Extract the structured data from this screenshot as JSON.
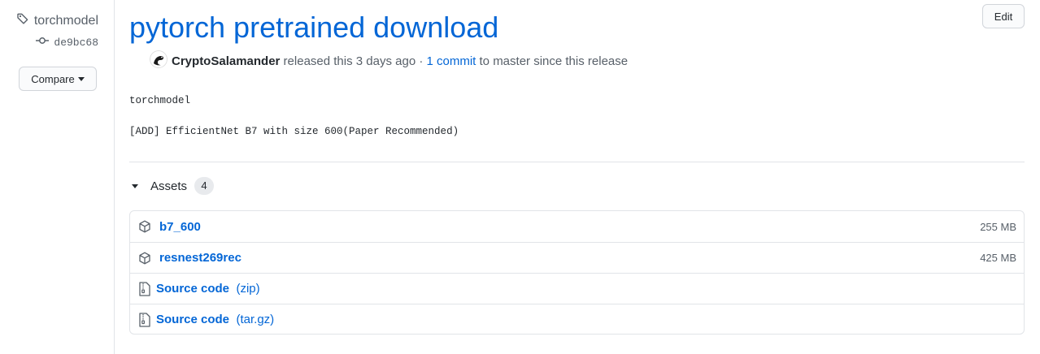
{
  "sidebar": {
    "tag_name": "torchmodel",
    "commit_sha": "de9bc68",
    "compare_label": "Compare"
  },
  "release": {
    "title": "pytorch pretrained download",
    "edit_label": "Edit",
    "author": "CryptoSalamander",
    "released_text": " released this 3 days ago · ",
    "commit_link": "1 commit",
    "commit_suffix": " to master since this release",
    "body_line1": "torchmodel",
    "body_line2": "[ADD] EfficientNet B7 with size 600(Paper Recommended)"
  },
  "assets": {
    "header": "Assets",
    "count": "4",
    "items": [
      {
        "name": "b7_600",
        "size": "255 MB",
        "icon": "package-icon"
      },
      {
        "name": "resnest269rec",
        "size": "425 MB",
        "icon": "package-icon"
      }
    ],
    "sources": [
      {
        "name": "Source code",
        "ext": "(zip)",
        "icon": "file-zip-icon"
      },
      {
        "name": "Source code",
        "ext": "(tar.gz)",
        "icon": "file-zip-icon"
      }
    ]
  }
}
